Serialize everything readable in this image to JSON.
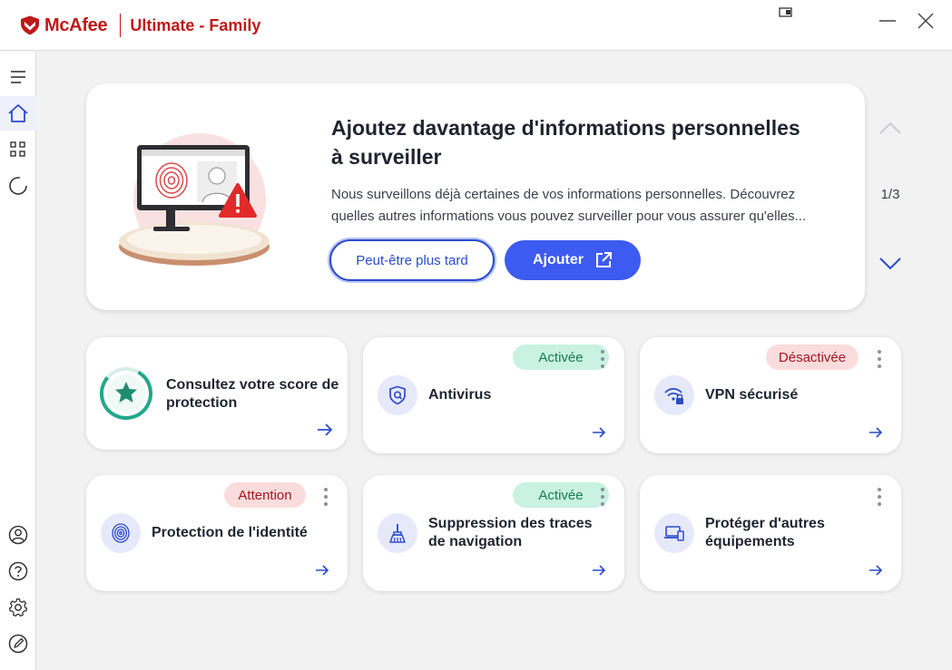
{
  "titlebar": {
    "brand": "McAfee",
    "product": "Ultimate - Family"
  },
  "sidebar": {
    "items": [
      {
        "icon": "menu-icon"
      },
      {
        "icon": "home-icon",
        "active": true
      },
      {
        "icon": "apps-grid-icon"
      },
      {
        "icon": "progress-circle-icon"
      },
      {
        "icon": "account-icon"
      },
      {
        "icon": "help-icon"
      },
      {
        "icon": "gear-icon"
      },
      {
        "icon": "feedback-icon"
      }
    ]
  },
  "banner": {
    "title": "Ajoutez davantage d'informations personnelles à surveiller",
    "description": "Nous surveillons déjà certaines de vos informations personnelles. Découvrez quelles autres informations vous pouvez surveiller pour vous assurer qu'elles...",
    "later_label": "Peut-être plus tard",
    "add_label": "Ajouter",
    "page_indicator": "1/3"
  },
  "cards": [
    {
      "title": "Consultez votre score de protection",
      "badge": null,
      "icon": "score-star-icon"
    },
    {
      "title": "Antivirus",
      "badge": "Activée",
      "badge_color": "#c9f2e3",
      "icon": "shield-icon"
    },
    {
      "title": "VPN sécurisé",
      "badge": "Désactivée",
      "badge_color": "#fbdcdc",
      "icon": "vpn-wifi-lock-icon"
    },
    {
      "title": "Protection de l'identité",
      "badge": "Attention",
      "badge_color": "#fbdcdc",
      "icon": "fingerprint-icon"
    },
    {
      "title": "Suppression des traces de navigation",
      "badge": "Activée",
      "badge_color": "#c9f2e3",
      "icon": "broom-icon"
    },
    {
      "title": "Protéger d'autres équipements",
      "badge": null,
      "icon": "devices-icon"
    }
  ],
  "colors": {
    "brand": "#c01818",
    "accent": "#3d5bf0",
    "active_badge": "#c9f2e3",
    "warning_badge": "#fbdcdc"
  }
}
